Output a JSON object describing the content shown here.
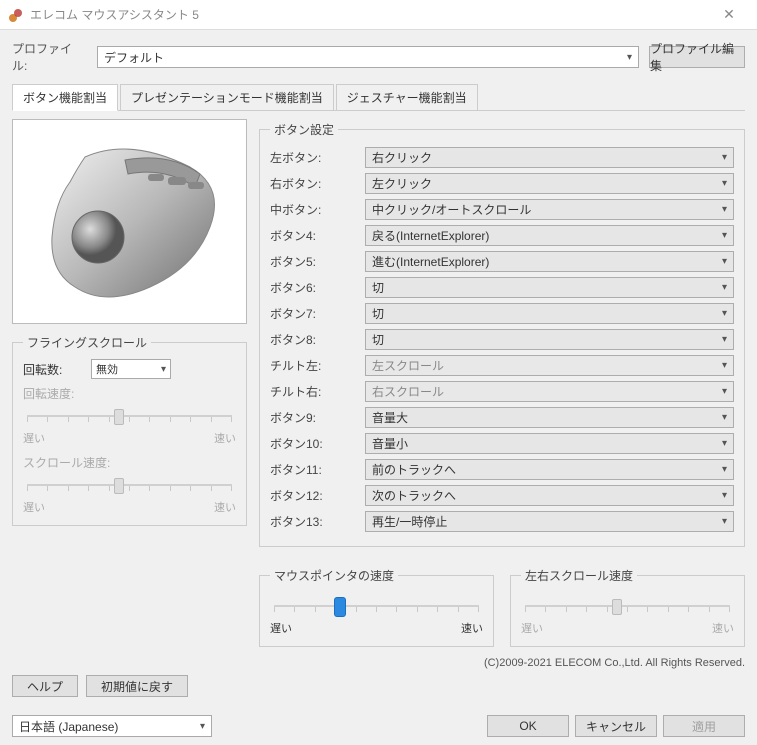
{
  "window": {
    "title": "エレコム マウスアシスタント 5"
  },
  "profile": {
    "label": "プロファイル:",
    "selected": "デフォルト",
    "edit_button": "プロファイル編集"
  },
  "tabs": {
    "tab0": "ボタン機能割当",
    "tab1": "プレゼンテーションモード機能割当",
    "tab2": "ジェスチャー機能割当"
  },
  "flying_scroll": {
    "legend": "フライングスクロール",
    "rotation_label": "回転数:",
    "rotation_value": "無効",
    "rotation_speed_label": "回転速度:",
    "scroll_speed_label": "スクロール速度:",
    "slow": "遅い",
    "fast": "速い"
  },
  "button_settings": {
    "legend": "ボタン設定",
    "rows": [
      {
        "label": "左ボタン:",
        "value": "右クリック",
        "enabled": true
      },
      {
        "label": "右ボタン:",
        "value": "左クリック",
        "enabled": true
      },
      {
        "label": "中ボタン:",
        "value": "中クリック/オートスクロール",
        "enabled": true
      },
      {
        "label": "ボタン4:",
        "value": "戻る(InternetExplorer)",
        "enabled": true
      },
      {
        "label": "ボタン5:",
        "value": "進む(InternetExplorer)",
        "enabled": true
      },
      {
        "label": "ボタン6:",
        "value": "切",
        "enabled": true
      },
      {
        "label": "ボタン7:",
        "value": "切",
        "enabled": true
      },
      {
        "label": "ボタン8:",
        "value": "切",
        "enabled": true
      },
      {
        "label": "チルト左:",
        "value": "左スクロール",
        "enabled": false
      },
      {
        "label": "チルト右:",
        "value": "右スクロール",
        "enabled": false
      },
      {
        "label": "ボタン9:",
        "value": "音量大",
        "enabled": true
      },
      {
        "label": "ボタン10:",
        "value": "音量小",
        "enabled": true
      },
      {
        "label": "ボタン11:",
        "value": "前のトラックへ",
        "enabled": true
      },
      {
        "label": "ボタン12:",
        "value": "次のトラックへ",
        "enabled": true
      },
      {
        "label": "ボタン13:",
        "value": "再生/一時停止",
        "enabled": true
      }
    ]
  },
  "pointer_speed": {
    "legend": "マウスポインタの速度",
    "slow": "遅い",
    "fast": "速い"
  },
  "tilt_speed": {
    "legend": "左右スクロール速度",
    "slow": "遅い",
    "fast": "速い"
  },
  "copyright": "(C)2009-2021 ELECOM Co.,Ltd. All Rights Reserved.",
  "buttons": {
    "help": "ヘルプ",
    "reset": "初期値に戻す",
    "ok": "OK",
    "cancel": "キャンセル",
    "apply": "適用"
  },
  "language": {
    "selected": "日本語 (Japanese)"
  }
}
